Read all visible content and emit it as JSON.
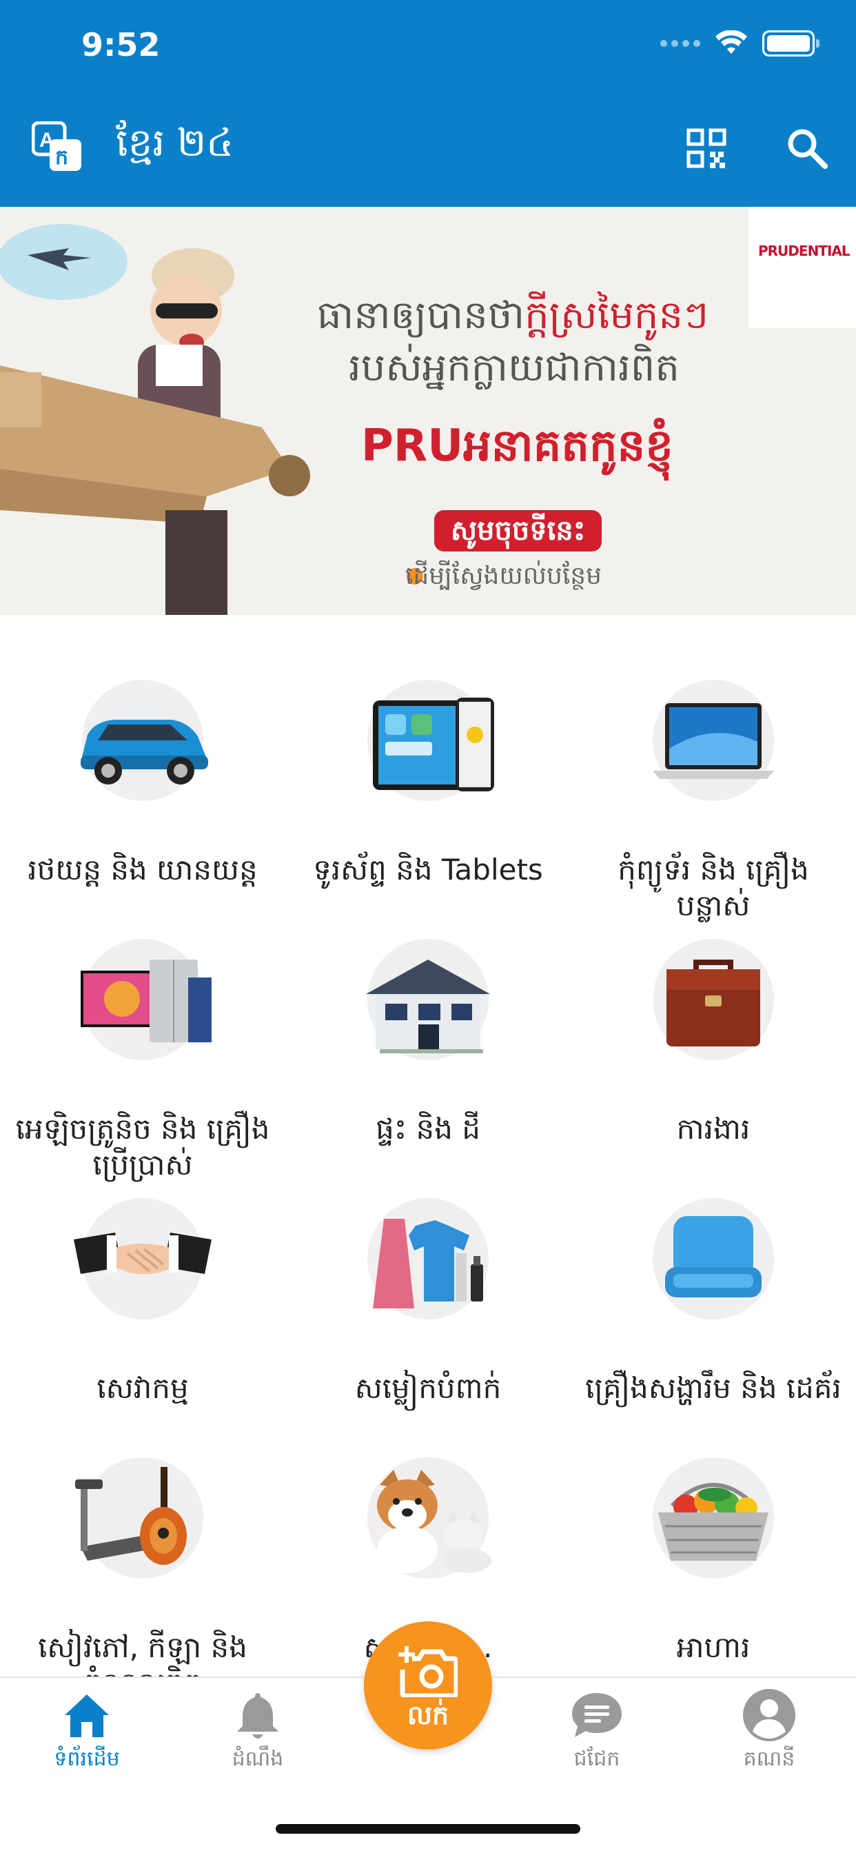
{
  "status_bar": {
    "time": "9:52"
  },
  "header": {
    "title": "ខ្មែរ ២៤",
    "icons": [
      "translate-icon",
      "qr-code-icon",
      "search-icon"
    ],
    "background_color": "#0b80c9"
  },
  "banner": {
    "brand": "PRUDENTIAL",
    "line1_start": "ធានាឲ្យបានថា",
    "line1_highlight": "ក្ដីស្រមៃកូនៗ",
    "line2": "របស់អ្នកក្លាយជាការពិត",
    "headline_brand": "PRU",
    "headline_rest": "អនាគតកូនខ្ញុំ",
    "cta": "សូមចុចទីនេះ",
    "subtext": "ដើម្បីស្វែងយល់បន្ថែម"
  },
  "categories": [
    {
      "label": "រថយន្ត និង យានយន្ត",
      "icon": "car-icon"
    },
    {
      "label": "ទូរស័ព្ទ និង Tablets",
      "icon": "phone-tablet-icon"
    },
    {
      "label": "កុំព្យូទ័រ និង គ្រឿងបន្លាស់",
      "icon": "laptop-icon"
    },
    {
      "label": "អេឡិចត្រូនិច និង គ្រឿងប្រើប្រាស់",
      "icon": "electronics-icon"
    },
    {
      "label": "ផ្ទះ និង ដី",
      "icon": "house-icon"
    },
    {
      "label": "ការងារ",
      "icon": "briefcase-icon"
    },
    {
      "label": "សេវាកម្ម",
      "icon": "handshake-icon"
    },
    {
      "label": "សម្លៀកបំពាក់",
      "icon": "clothing-icon"
    },
    {
      "label": "គ្រឿងសង្ហារឹម និង ដេគ័រ",
      "icon": "chair-icon"
    },
    {
      "label": "សៀវភៅ, កីឡា និង ចំណូលចិត្ត",
      "icon": "hobbies-icon"
    },
    {
      "label": "សត្វ និង ...",
      "icon": "pets-icon"
    },
    {
      "label": "អាហារ",
      "icon": "food-basket-icon"
    }
  ],
  "bottom_nav": {
    "home": "ទំព័រដើម",
    "notifications": "ដំណឹង",
    "sell": "លក់",
    "chat": "ជជែក",
    "account": "គណនី"
  },
  "colors": {
    "primary": "#0b80c9",
    "accent": "#f7931e",
    "banner_red": "#d0202e"
  }
}
